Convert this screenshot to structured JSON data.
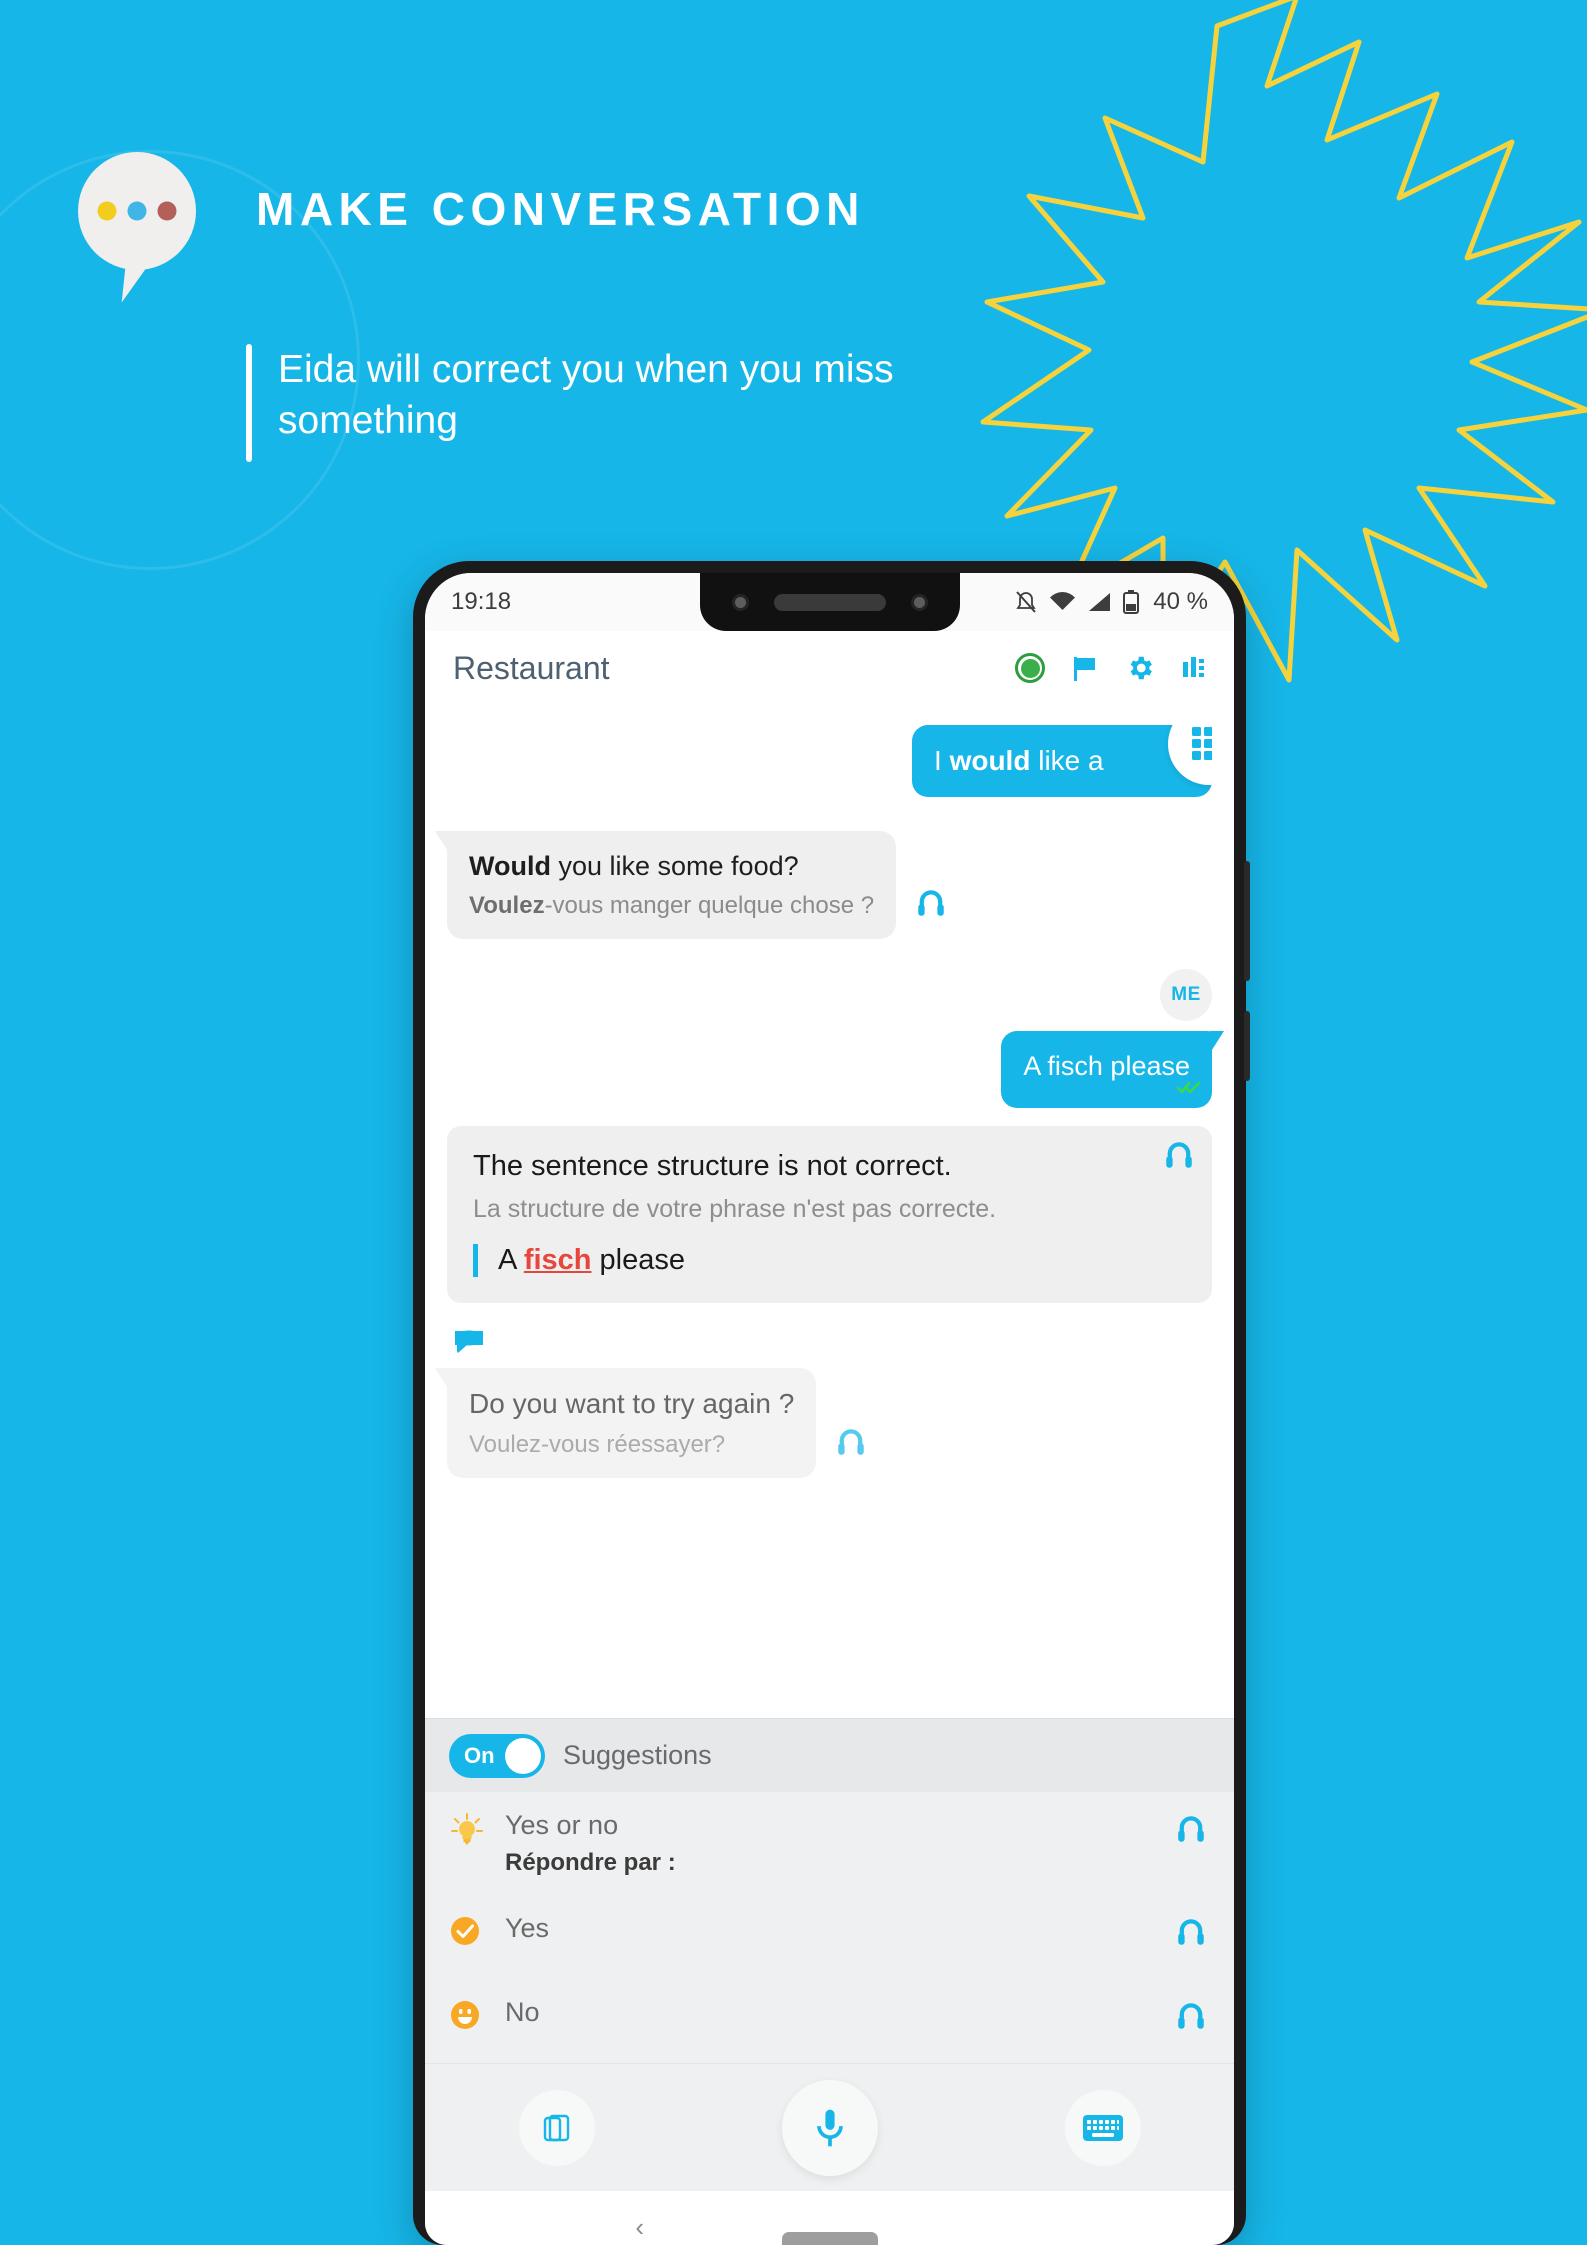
{
  "theme": {
    "brand_blue": "#16b6e8",
    "accent_yellow": "#f6d33c",
    "error_red": "#e8453c",
    "green": "#39b04a",
    "orange": "#f9a825"
  },
  "promo": {
    "headline": "MAKE CONVERSATION",
    "subtitle": "Eida will correct you when you miss something",
    "logo_dots": [
      "#f2cc1f",
      "#3fb6e6",
      "#b4605a"
    ]
  },
  "phone": {
    "statusbar": {
      "time": "19:18",
      "battery_percent": "40 %",
      "icons": [
        "mute-icon",
        "wifi-icon",
        "signal-icon",
        "battery-icon"
      ]
    },
    "appbar": {
      "title": "Restaurant",
      "actions": [
        "record-status-icon",
        "flag-icon",
        "gear-icon",
        "stats-icon"
      ]
    },
    "chat": {
      "messages": [
        {
          "id": "msg-1",
          "side": "me",
          "text_bold": "I would",
          "text_prefix": "I ",
          "text_strong": "would",
          "text_rest": " like a ",
          "truncated": true,
          "badge": "grid-icon"
        },
        {
          "id": "msg-2",
          "side": "them",
          "primary_strong": "Would",
          "primary_rest": " you like some food?",
          "secondary_strong": "Voulez",
          "secondary_rest": "-vous manger quelque chose ?",
          "audio": "headphones-icon"
        },
        {
          "id": "msg-3",
          "side": "me",
          "avatar_label": "ME",
          "text": "A fisch please",
          "status": "read-double-check"
        }
      ],
      "correction": {
        "title": "The sentence structure is not correct.",
        "subtitle": "La structure de votre phrase n'est pas correcte.",
        "quote_prefix": "A ",
        "quote_error": "fisch",
        "quote_suffix": " please",
        "audio": "headphones-icon"
      },
      "retry": {
        "primary": "Do you want to try again ?",
        "secondary": "Voulez-vous réessayer?",
        "audio": "headphones-icon",
        "marker": "speech-bubble-icon"
      }
    },
    "suggestions": {
      "toggle_label": "On",
      "toggle_state": "on",
      "section_label": "Suggestions",
      "items": [
        {
          "id": "sugg-yes-or-no",
          "icon": "lightbulb-icon",
          "label": "Yes or no",
          "sublabel": "Répondre par :",
          "audio": "headphones-icon"
        },
        {
          "id": "sugg-yes",
          "icon": "check-circle-icon",
          "label": "Yes",
          "sublabel": "",
          "audio": "headphones-icon"
        },
        {
          "id": "sugg-no",
          "icon": "smiley-icon",
          "label": "No",
          "sublabel": "",
          "audio": "headphones-icon"
        }
      ]
    },
    "actionbar": {
      "buttons": [
        "cards-icon",
        "microphone-icon",
        "keyboard-icon"
      ]
    },
    "navbar": {
      "back": "‹",
      "home": "home-pill"
    }
  }
}
